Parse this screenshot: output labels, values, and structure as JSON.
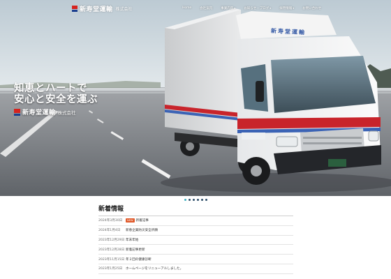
{
  "site": {
    "brand_name": "新寿堂運輸",
    "brand_suffix": "株式会社"
  },
  "nav": {
    "items": [
      {
        "label": "Home",
        "dropdown": false
      },
      {
        "label": "会社案内",
        "dropdown": false
      },
      {
        "label": "事業内容",
        "dropdown": true
      },
      {
        "label": "お知らせ・ブログ",
        "dropdown": true
      },
      {
        "label": "採用情報",
        "dropdown": true
      },
      {
        "label": "お問い合わせ",
        "dropdown": false
      }
    ]
  },
  "hero": {
    "slogan_line1": "知恵とハートで",
    "slogan_line2": "安心と安全を運ぶ",
    "brand_name": "新寿堂運輸",
    "brand_suffix": "株式会社",
    "truck_side_text": "新寿堂運輸"
  },
  "slider": {
    "slide_count": 6,
    "active_index": 0
  },
  "news": {
    "title": "新着情報",
    "items": [
      {
        "date": "2024年3月30日",
        "badge": "NEW",
        "text": "新着記事"
      },
      {
        "date": "2024年1月4日",
        "badge": "",
        "text": "新春企業防災安全祈願"
      },
      {
        "date": "2023年12月29日",
        "badge": "",
        "text": "年末年始"
      },
      {
        "date": "2023年12月28日",
        "badge": "",
        "text": "新着記事更新"
      },
      {
        "date": "2023年11月15日",
        "badge": "",
        "text": "年２回の健康診断"
      },
      {
        "date": "2023年1月25日",
        "badge": "",
        "text": "ホームページをリニューアルしました。"
      }
    ]
  },
  "colors": {
    "brand_red": "#d6231e",
    "brand_blue": "#1b3f8f",
    "badge_new": "#e05a2b",
    "dot_active": "#3fb1c0",
    "dot_inactive": "#2d4e6a"
  }
}
